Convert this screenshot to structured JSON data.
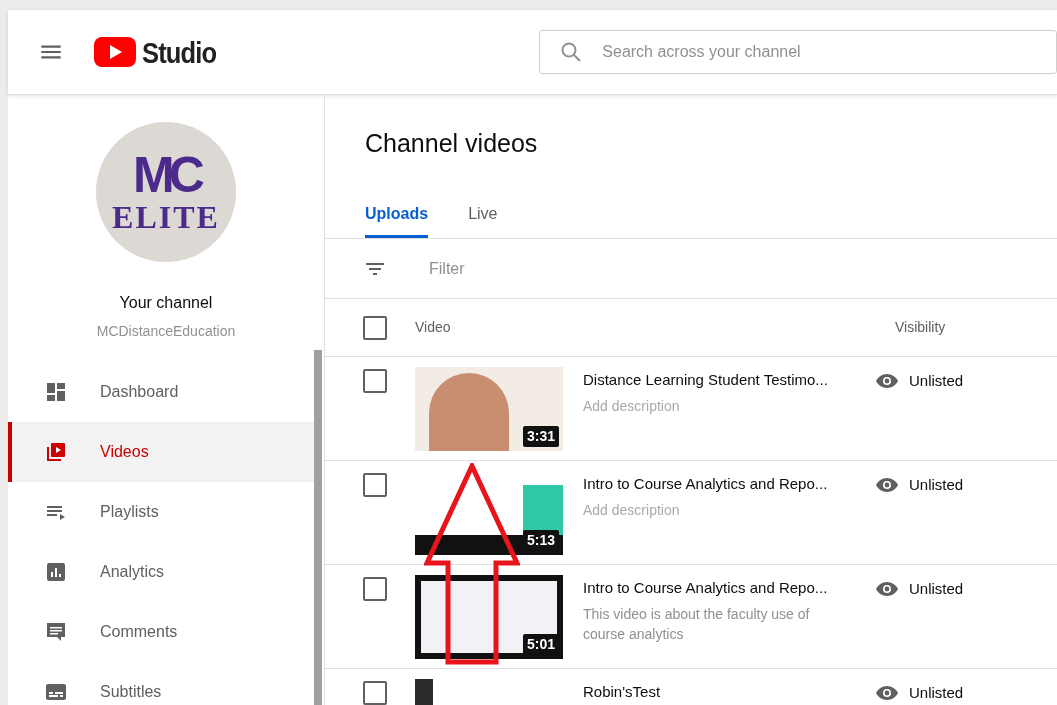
{
  "header": {
    "brand": "Studio",
    "search": {
      "placeholder": "Search across your channel"
    }
  },
  "channel": {
    "logo_lines": [
      "MC",
      "ELITE"
    ],
    "title": "Your channel",
    "name": "MCDistanceEducation"
  },
  "sidebar": {
    "items": [
      {
        "label": "Dashboard",
        "kind": "dashboard",
        "selected": false
      },
      {
        "label": "Videos",
        "kind": "videos",
        "selected": true
      },
      {
        "label": "Playlists",
        "kind": "playlists",
        "selected": false
      },
      {
        "label": "Analytics",
        "kind": "analytics",
        "selected": false
      },
      {
        "label": "Comments",
        "kind": "comments",
        "selected": false
      },
      {
        "label": "Subtitles",
        "kind": "subtitles",
        "selected": false
      }
    ]
  },
  "page_title": "Channel videos",
  "tabs": [
    {
      "label": "Uploads",
      "selected": true
    },
    {
      "label": "Live",
      "selected": false
    }
  ],
  "filter": {
    "placeholder": "Filter"
  },
  "table": {
    "columns": [
      "Video",
      "Visibility"
    ],
    "header_checked": false,
    "rows": [
      {
        "checked": false,
        "kind": "photo",
        "duration": "3:31",
        "title": "Distance Learning Student Testimo...",
        "description": "Add description",
        "description_placeholder": true,
        "visibility": "Unlisted"
      },
      {
        "checked": false,
        "kind": "slide",
        "duration": "5:13",
        "title": "Intro to Course Analytics and Repo...",
        "description": "Add description",
        "description_placeholder": true,
        "visibility": "Unlisted"
      },
      {
        "checked": false,
        "kind": "screen",
        "duration": "5:01",
        "title": "Intro to Course Analytics and Repo...",
        "description": "This video is about the faculty use of course analytics",
        "description_placeholder": false,
        "visibility": "Unlisted"
      },
      {
        "checked": false,
        "kind": "dark",
        "title": "Robin'sTest",
        "visibility": "Unlisted"
      }
    ]
  }
}
